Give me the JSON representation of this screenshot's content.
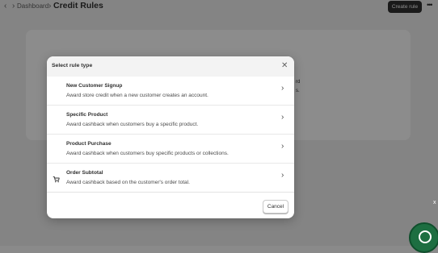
{
  "header": {
    "breadcrumb_link": "Dashboard",
    "breadcrumb_sep": "›",
    "title": "Credit Rules",
    "create_button": "Create rule",
    "more_icon": "ellipsis-icon",
    "more_glyph": "•••"
  },
  "card": {
    "line1": "rd",
    "line2": "s."
  },
  "modal": {
    "title": "Select rule type",
    "close_glyph": "✕",
    "options": [
      {
        "title": "New Customer Signup",
        "description": "Award store credit when a new customer creates an account.",
        "icon": ""
      },
      {
        "title": "Specific Product",
        "description": "Award cashback when customers buy a specific product.",
        "icon": ""
      },
      {
        "title": "Product Purchase",
        "description": "Award cashback when customers buy specific products or collections.",
        "icon": ""
      },
      {
        "title": "Order Subtotal",
        "description": "Award cashback based on the customer's order total.",
        "icon": "cart-icon"
      }
    ],
    "chevron": "›",
    "cancel_button": "Cancel"
  },
  "widget": {
    "close_glyph": "x"
  },
  "colors": {
    "primary_button": "#303030",
    "overlay": "rgba(0,0,0,0.45)",
    "widget": "#1d6e41"
  }
}
